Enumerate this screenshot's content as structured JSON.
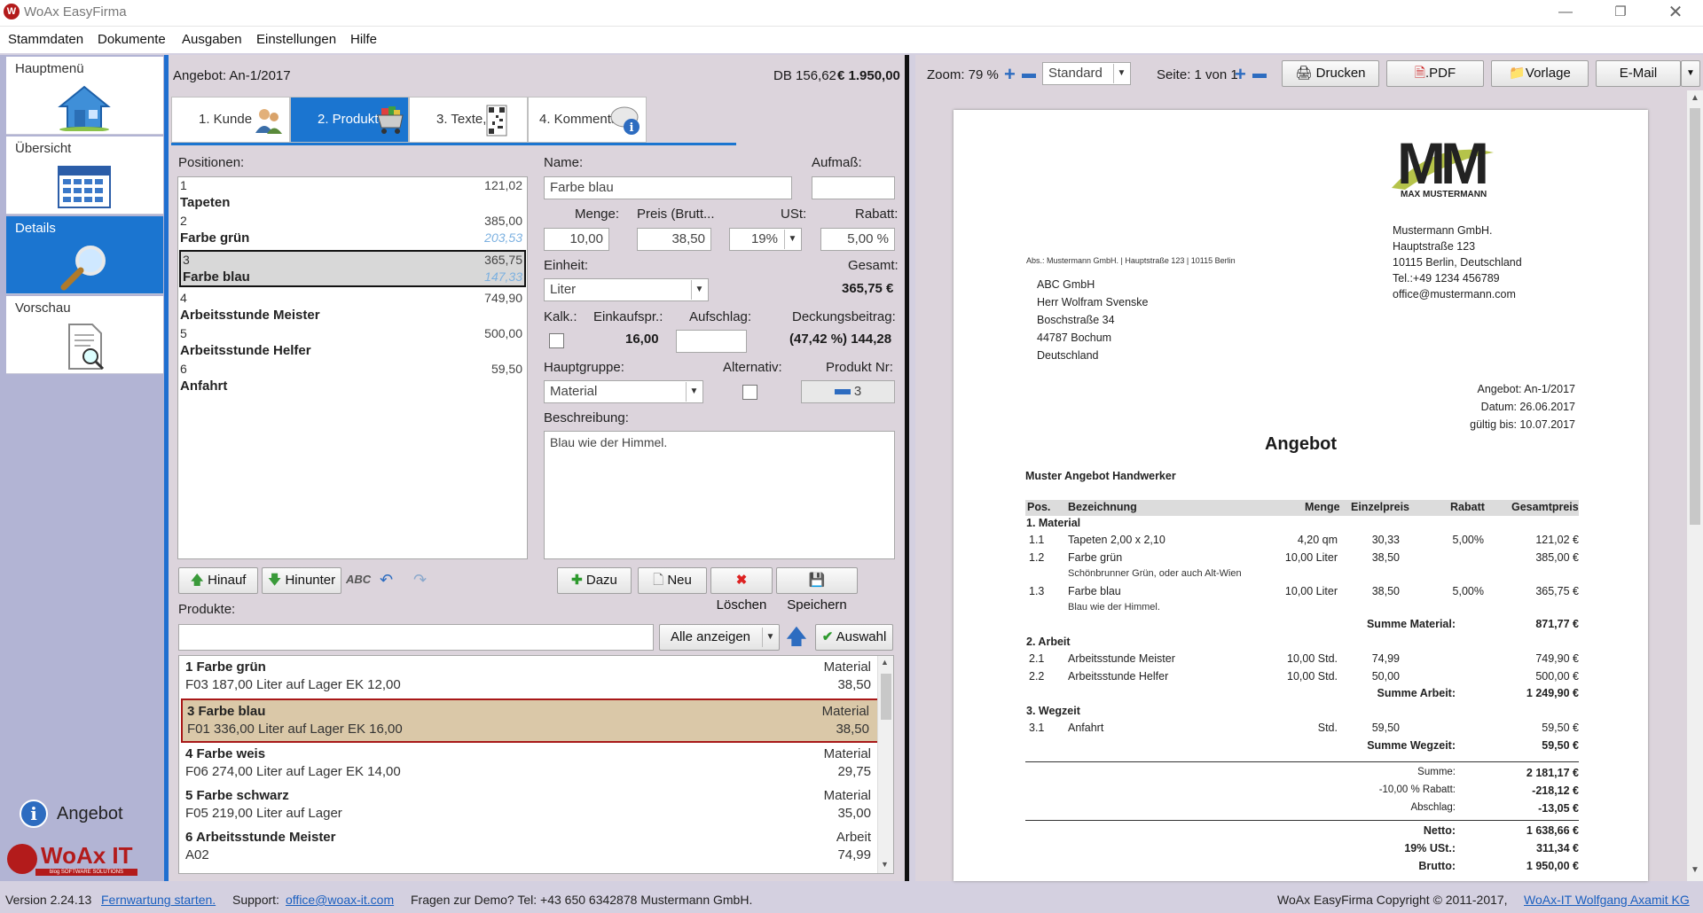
{
  "window": {
    "title": "WoAx EasyFirma",
    "app_icon": "W"
  },
  "menu": [
    "Stammdaten",
    "Dokumente",
    "Ausgaben",
    "Einstellungen",
    "Hilfe"
  ],
  "nav": {
    "items": [
      {
        "label": "Hauptmenü",
        "icon": "house-icon"
      },
      {
        "label": "Übersicht",
        "icon": "calendar-icon"
      },
      {
        "label": "Details",
        "icon": "magnifier-icon"
      },
      {
        "label": "Vorschau",
        "icon": "document-search-icon"
      }
    ],
    "footer_label": "Angebot",
    "brand": "WoAx IT",
    "brand_sub": "blog SOFTWARE SOLUTIONS"
  },
  "header": {
    "title": "Angebot: An-1/2017",
    "db": "DB 156,62",
    "total": "€ 1.950,00"
  },
  "tabs": [
    "1. Kunde",
    "2. Produkte",
    "3. Texte, ...",
    "4. Kommentar"
  ],
  "positions": {
    "label": "Positionen:",
    "rows": [
      {
        "n": "1",
        "v": "121,02",
        "name": "Tapeten",
        "extra": ""
      },
      {
        "n": "2",
        "v": "385,00",
        "name": "Farbe grün",
        "extra": "203,53"
      },
      {
        "n": "3",
        "v": "365,75",
        "name": "Farbe blau",
        "extra": "147,33"
      },
      {
        "n": "4",
        "v": "749,90",
        "name": "Arbeitsstunde Meister",
        "extra": ""
      },
      {
        "n": "5",
        "v": "500,00",
        "name": "Arbeitsstunde Helfer",
        "extra": ""
      },
      {
        "n": "6",
        "v": "59,50",
        "name": "Anfahrt",
        "extra": ""
      }
    ]
  },
  "form": {
    "name_label": "Name:",
    "name_value": "Farbe blau",
    "aufmass_label": "Aufmaß:",
    "aufmass_value": "",
    "menge_label": "Menge:",
    "menge_value": "10,00",
    "preis_label": "Preis (Brutt...",
    "preis_value": "38,50",
    "ust_label": "USt:",
    "ust_value": "19%",
    "rabatt_label": "Rabatt:",
    "rabatt_value": "5,00 %",
    "einheit_label": "Einheit:",
    "einheit_value": "Liter",
    "gesamt_label": "Gesamt:",
    "gesamt_value": "365,75 €",
    "kalk_label": "Kalk.:",
    "einkauf_label": "Einkaufspr.:",
    "einkauf_value": "16,00",
    "aufschlag_label": "Aufschlag:",
    "aufschlag_value": "",
    "deckung_label": "Deckungsbeitrag:",
    "deckung_value": "(47,42 %) 144,28",
    "hauptgruppe_label": "Hauptgruppe:",
    "hauptgruppe_value": "Material",
    "alternativ_label": "Alternativ:",
    "produktnr_label": "Produkt Nr:",
    "produktnr_value": "3",
    "beschreibung_label": "Beschreibung:",
    "beschreibung_value": "Blau wie der Himmel."
  },
  "pos_buttons": {
    "hinauf": "Hinauf",
    "hinunter": "Hinunter"
  },
  "form_buttons": {
    "dazu": "Dazu",
    "neu": "Neu",
    "loeschen": "Löschen",
    "speichern": "Speichern"
  },
  "products": {
    "label": "Produkte:",
    "search_value": "",
    "filter": "Alle anzeigen",
    "auswahl": "Auswahl",
    "rows": [
      {
        "title": "1 Farbe grün",
        "sub": "F03 187,00 Liter auf Lager EK 12,00",
        "group": "Material",
        "price": "38,50"
      },
      {
        "title": "3 Farbe blau",
        "sub": "F01 336,00 Liter auf Lager EK 16,00",
        "group": "Material",
        "price": "38,50"
      },
      {
        "title": "4 Farbe weis",
        "sub": "F06 274,00 Liter auf Lager EK 14,00",
        "group": "Material",
        "price": "29,75"
      },
      {
        "title": "5 Farbe schwarz",
        "sub": "F05 219,00 Liter auf Lager",
        "group": "Material",
        "price": "35,00"
      },
      {
        "title": "6 Arbeitsstunde Meister",
        "sub": "A02",
        "group": "Arbeit",
        "price": "74,99"
      }
    ]
  },
  "preview_toolbar": {
    "zoom": "Zoom: 79 %",
    "template": "Standard",
    "page": "Seite: 1 von 1",
    "print": "Drucken",
    "pdf": ".PDF",
    "vorlage": "Vorlage",
    "email": "E-Mail"
  },
  "doc": {
    "logo": "MM",
    "logo_sub": "MAX MUSTERMANN",
    "sender_line": "Abs.: Mustermann GmbH. | Hauptstraße 123 | 10115 Berlin",
    "company": [
      "Mustermann GmbH.",
      "Hauptstraße 123",
      "10115 Berlin, Deutschland",
      "Tel.:+49 1234 456789",
      "office@mustermann.com"
    ],
    "recipient": [
      "ABC GmbH",
      "Herr Wolfram Svenske",
      "Boschstraße 34",
      "44787 Bochum",
      "Deutschland"
    ],
    "meta": [
      "Angebot: An-1/2017",
      "Datum: 26.06.2017",
      "gültig bis: 10.07.2017"
    ],
    "title": "Angebot",
    "subtitle": "Muster Angebot Handwerker",
    "cols": [
      "Pos.",
      "Bezeichnung",
      "Menge",
      "Einzelpreis",
      "Rabatt",
      "Gesamtpreis"
    ],
    "g1": "1. Material",
    "r11": [
      "1.1",
      "Tapeten 2,00 x 2,10",
      "4,20 qm",
      "30,33",
      "5,00%",
      "121,02 €"
    ],
    "r12": [
      "1.2",
      "Farbe grün",
      "10,00 Liter",
      "38,50",
      "",
      "385,00 €"
    ],
    "r12d": "Schönbrunner Grün, oder auch Alt-Wien",
    "r13": [
      "1.3",
      "Farbe blau",
      "10,00 Liter",
      "38,50",
      "5,00%",
      "365,75 €"
    ],
    "r13d": "Blau wie der Himmel.",
    "s1": [
      "Summe Material:",
      "871,77 €"
    ],
    "g2": "2. Arbeit",
    "r21": [
      "2.1",
      "Arbeitsstunde Meister",
      "10,00 Std.",
      "74,99",
      "",
      "749,90 €"
    ],
    "r22": [
      "2.2",
      "Arbeitsstunde Helfer",
      "10,00 Std.",
      "50,00",
      "",
      "500,00 €"
    ],
    "s2": [
      "Summe Arbeit:",
      "1 249,90 €"
    ],
    "g3": "3. Wegzeit",
    "r31": [
      "3.1",
      "Anfahrt",
      "Std.",
      "59,50",
      "",
      "59,50 €"
    ],
    "s3": [
      "Summe Wegzeit:",
      "59,50 €"
    ],
    "t1": [
      "Summe:",
      "2 181,17 €"
    ],
    "t2": [
      "-10,00 % Rabatt:",
      "-218,12 €"
    ],
    "t3": [
      "Abschlag:",
      "-13,05 €"
    ],
    "t4": [
      "Netto:",
      "1 638,66 €"
    ],
    "t5": [
      "19%  USt.:",
      "311,34 €"
    ],
    "t6": [
      "Brutto:",
      "1 950,00 €"
    ]
  },
  "status": {
    "version": "Version 2.24.13",
    "remote": "Fernwartung starten.",
    "support_label": "Support:",
    "support_email": "office@woax-it.com",
    "demo": "Fragen zur Demo? Tel: +43 650 6342878 Mustermann GmbH.",
    "copyright": "WoAx EasyFirma Copyright © 2011-2017,",
    "company_link": "WoAx-IT Wolfgang Axamit KG"
  }
}
